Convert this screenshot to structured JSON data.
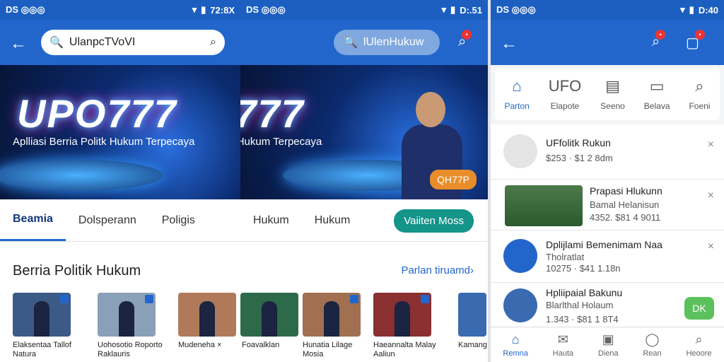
{
  "status_left": {
    "s1": "DS ◎◎◎",
    "s2": "DS ◎◎◎",
    "s3": "DS ◎◎◎"
  },
  "status_right": {
    "s1": "72:8X",
    "s2": "D:.51",
    "s3": "D:40"
  },
  "search": {
    "value": "UlanpcTVoVI"
  },
  "pill_search": {
    "label": "lUlenHukuw"
  },
  "hero": {
    "logo": "UPO777",
    "tagline": "Aplliasi Berria Politk Hukum Terpecaya",
    "badge": "QH77P"
  },
  "tabs": [
    "Beamia",
    "Dolsperann",
    "Poligis",
    "Hukum",
    "Hukum"
  ],
  "cta": "Vaiiten Moss",
  "section": {
    "title": "Berria Politik Hukum",
    "more": "Parlan tiruamd›"
  },
  "thumb_captions": [
    "Elaksentaa Tallof Natura",
    "Uohosotio Roporto Raklauris",
    "Mudeneha ×",
    "Foavalklan",
    "Hunatia Lilage Mosia",
    "Haeannalta Malay Aaliun",
    "Kamang"
  ],
  "categories": [
    "Parton",
    "Elapote",
    "Seeno",
    "Belava",
    "Foeni"
  ],
  "list": [
    {
      "title": "UFfolitk Rukun",
      "sub": "$253 · $1 2 8dm"
    },
    {
      "title": "Prapasi Hlukunn",
      "sub1": "Bamal Helanisun",
      "sub2": "4352. $81 4 9011"
    },
    {
      "title": "Dplijlami Bemenimam Naa",
      "sub1": "Tholratlat",
      "sub2": "10275 · $41 1.18n"
    },
    {
      "title": "Hpliipaial Bakunu",
      "sub1": "Blarlthal Holaum",
      "sub2": "1.343 · $81 1 8T4",
      "btn": "DK"
    }
  ],
  "bottom_nav": [
    "Remna",
    "Hauta",
    "Diena",
    "Rean",
    "Heoore"
  ],
  "colors": {
    "primary": "#2266cc",
    "accent": "#15948a"
  }
}
